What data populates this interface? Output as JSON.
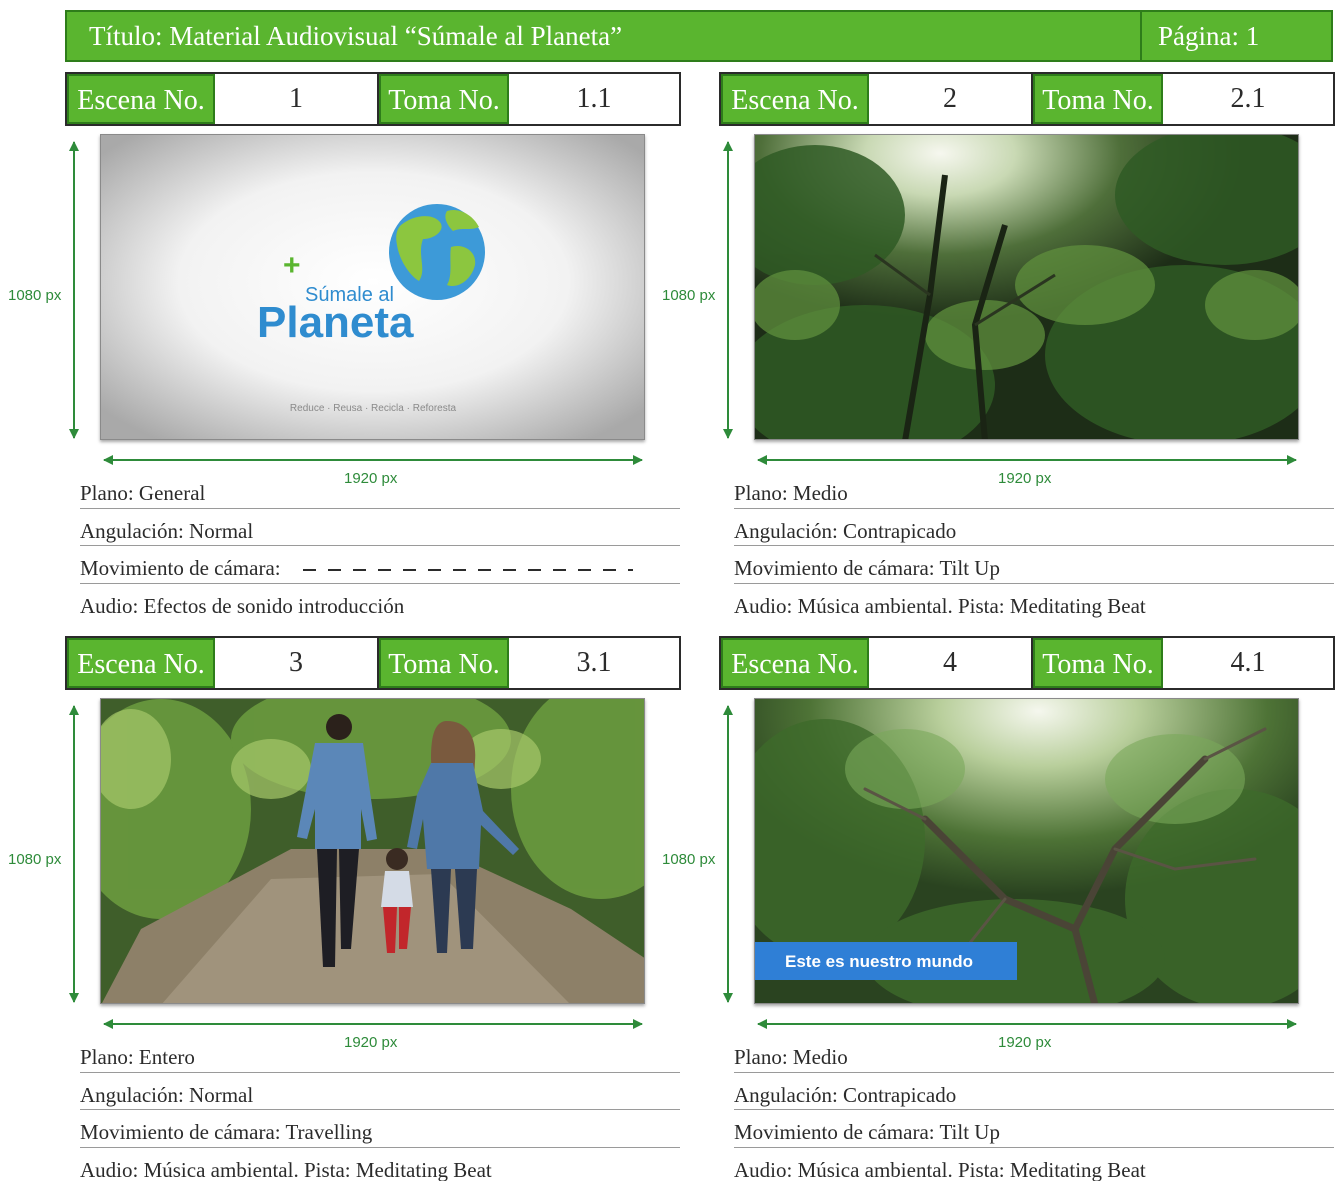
{
  "header": {
    "title": "Título: Material Audiovisual “Súmale al Planeta”",
    "page": "Página: 1",
    "accent_color": "#5ab52f"
  },
  "labels": {
    "scene": "Escena No.",
    "take": "Toma No."
  },
  "dimensions": {
    "height_label": "1080 px",
    "width_label": "1920 px"
  },
  "scenes": [
    {
      "scene_no": "1",
      "take_no": "1.1",
      "image": "logo-card",
      "logo": {
        "tagline_top": "Súmale al",
        "wordmark": "Planeta",
        "slogan": "Reduce · Reusa · Recicla · Reforesta"
      },
      "plano": "Plano: General",
      "angulacion": "Angulación: Normal",
      "movimiento": "Movimiento de cámara:",
      "movimiento_empty": true,
      "audio": "Audio: Efectos de sonido introducción"
    },
    {
      "scene_no": "2",
      "take_no": "2.1",
      "image": "forest-canopy-photo",
      "plano": "Plano: Medio",
      "angulacion": "Angulación: Contrapicado",
      "movimiento": "Movimiento de cámara: Tilt Up",
      "audio": "Audio: Música ambiental. Pista: Meditating Beat"
    },
    {
      "scene_no": "3",
      "take_no": "3.1",
      "image": "family-walking-trail-photo",
      "plano": "Plano: Entero",
      "angulacion": "Angulación: Normal",
      "movimiento": "Movimiento de cámara: Travelling",
      "audio": "Audio: Música ambiental. Pista: Meditating Beat"
    },
    {
      "scene_no": "4",
      "take_no": "4.1",
      "image": "tree-branches-photo",
      "caption": "Este es nuestro mundo",
      "plano": "Plano: Medio",
      "angulacion": "Angulación: Contrapicado",
      "movimiento": "Movimiento de cámara: Tilt Up",
      "audio": "Audio: Música ambiental. Pista: Meditating Beat"
    }
  ]
}
